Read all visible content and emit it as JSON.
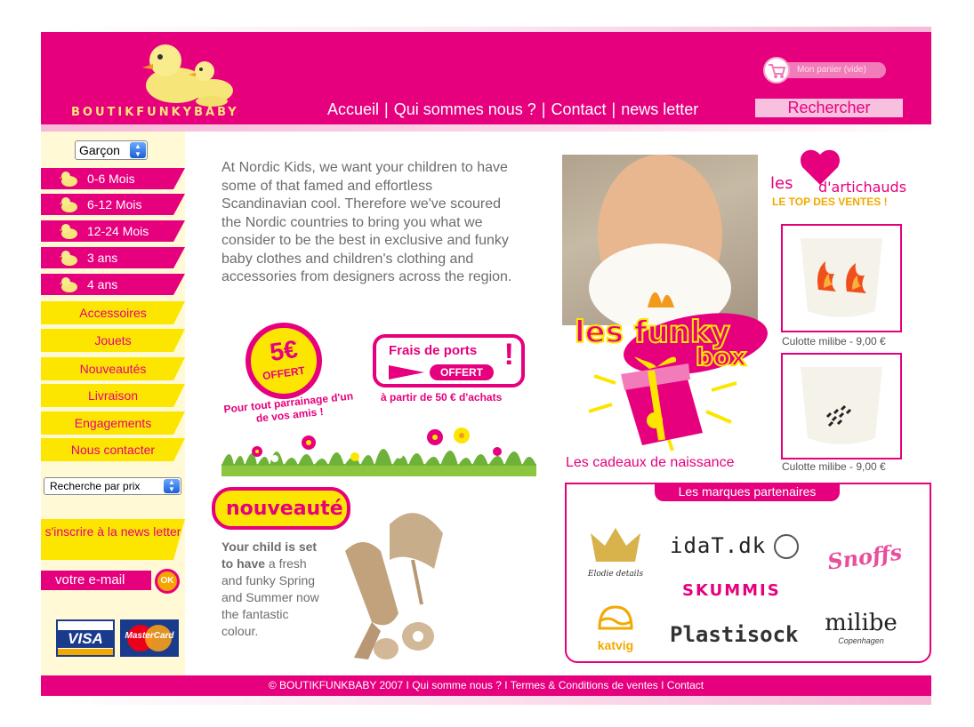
{
  "header": {
    "brand": "BOUTIKFUNKYBABY",
    "cart_label": "Mon panier (vide)",
    "nav": [
      "Accueil",
      "Qui sommes nous ?",
      "Contact",
      "news letter"
    ],
    "search_label": "Rechercher"
  },
  "sidebar": {
    "gender_select": "Garçon",
    "age_items": [
      "0-6 Mois",
      "6-12 Mois",
      "12-24 Mois",
      "3 ans",
      "4 ans"
    ],
    "menu_items": [
      "Accessoires",
      "Jouets",
      "Nouveautés",
      "Livraison",
      "Engagements",
      "Nous contacter"
    ],
    "price_select": "Recherche par prix",
    "newsletter_cta": "s'inscrire à la news letter",
    "email_placeholder": "votre e-mail",
    "ok_label": "OK",
    "visa_label": "VISA",
    "mastercard_label": "MasterCard"
  },
  "main": {
    "intro": "At Nordic Kids, we want your children to have some of that famed and effortless Scandinavian cool. Therefore we've scoured the Nordic countries to bring you what we consider to be the best in exclusive and funky baby clothes and children's clothing and accessories from designers across the region.",
    "offer_amount": "5€",
    "offer_word": "OFFERT",
    "offer_caption": "Pour tout parrainage d'un de vos amis !",
    "shipping_title": "Frais de ports",
    "shipping_pill": "OFFERT",
    "shipping_caption": "à partir de 50 € d'achats",
    "nouveaute_label": "nouveauté",
    "nouveaute_bold": "Your child is set to have",
    "nouveaute_rest": " a fresh and funky Spring and Summer now the fantastic colour.",
    "funky_box_line1": "les funky",
    "funky_box_line2": "box",
    "funky_caption": "Les cadeaux de naissance"
  },
  "top_sales": {
    "logo_word1": "les",
    "logo_word2": "d'artichauds",
    "title": "LE TOP DES VENTES !",
    "products": [
      {
        "caption": "Culotte milibe - 9,00 €"
      },
      {
        "caption": "Culotte milibe - 9,00 €"
      }
    ]
  },
  "partners": {
    "title": "Les marques partenaires",
    "brands": [
      "Elodie details",
      "idaT.dk",
      "Snoffs",
      "SKUMMIS",
      "katvig",
      "Plastisock",
      "milibe",
      "Copenhagen"
    ]
  },
  "footer": {
    "text": "© BOUTIKFUNKBABY 2007 I Qui somme nous ? I Termes & Conditions de ventes I Contact"
  },
  "colors": {
    "brand_pink": "#e6007e",
    "brand_yellow": "#fce600",
    "accent_orange": "#f2a900"
  }
}
